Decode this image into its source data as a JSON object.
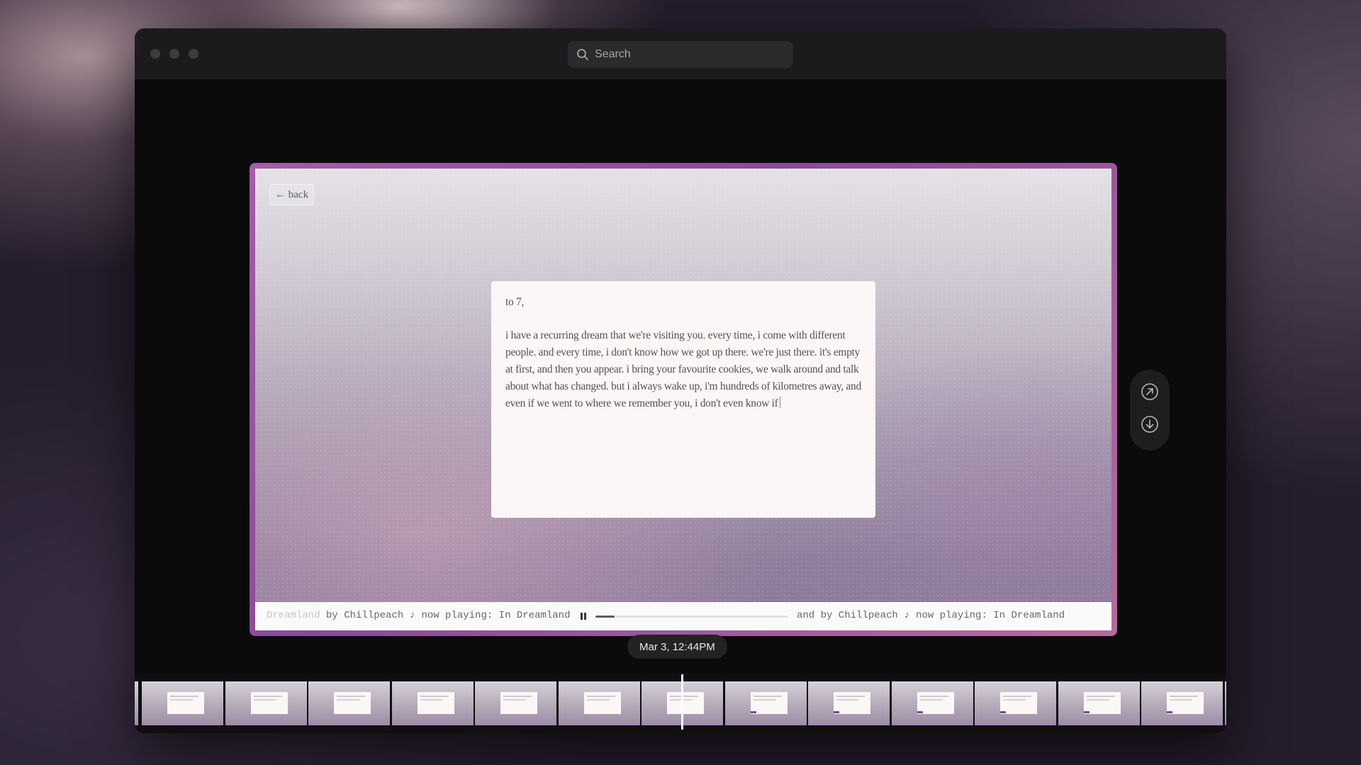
{
  "window": {
    "search_placeholder": "Search"
  },
  "screen": {
    "back_label": "← back",
    "letter": {
      "greeting": "to 7,",
      "body": "i have a recurring dream that we're visiting you. every time, i come with different people. and every time, i don't know how we got up there. we're just there. it's empty at first, and then you appear. i bring your favourite cookies, we walk around and talk about what has changed. but i always wake up, i'm hundreds of kilometres away, and even if we went to where we remember you, i don't even know if"
    },
    "player": {
      "marquee_left_faded": "Dreamland",
      "marquee_left": " by Chillpeach ♪ now playing: In Dreamland",
      "marquee_right": "and by Chillpeach ♪ now playing: In Dreamland",
      "progress": 0.1,
      "state": "playing"
    }
  },
  "actions": {
    "open_icon": "arrow-up-right-circle-icon",
    "download_icon": "arrow-down-circle-icon"
  },
  "timeline": {
    "current_timestamp": "Mar 3, 12:44PM",
    "thumbnail_count": 14
  },
  "colors": {
    "frame_accent": "#a65ca8",
    "window_bg": "#0d0d0e"
  }
}
